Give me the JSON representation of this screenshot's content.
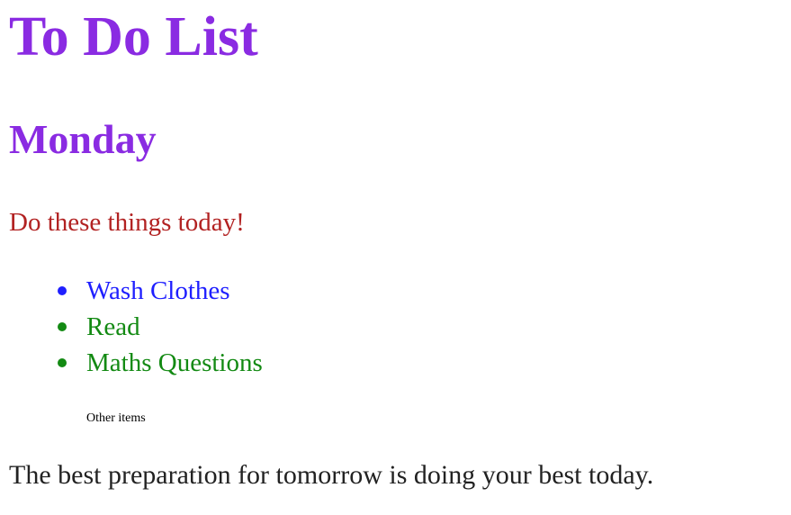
{
  "page": {
    "title": "To Do List",
    "day": "Monday",
    "intro": "Do these things today!",
    "other_items": "Other items",
    "quote": "The best preparation for tomorrow is doing your best today."
  },
  "colors": {
    "heading": "#8a2be2",
    "intro": "#b22222",
    "first_item": "#1f1fff",
    "other_item": "#138a13",
    "text": "#000000"
  },
  "todo": {
    "items": [
      {
        "label": "Wash Clothes",
        "color": "#1f1fff"
      },
      {
        "label": "Read",
        "color": "#138a13"
      },
      {
        "label": "Maths Questions",
        "color": "#138a13"
      }
    ]
  }
}
